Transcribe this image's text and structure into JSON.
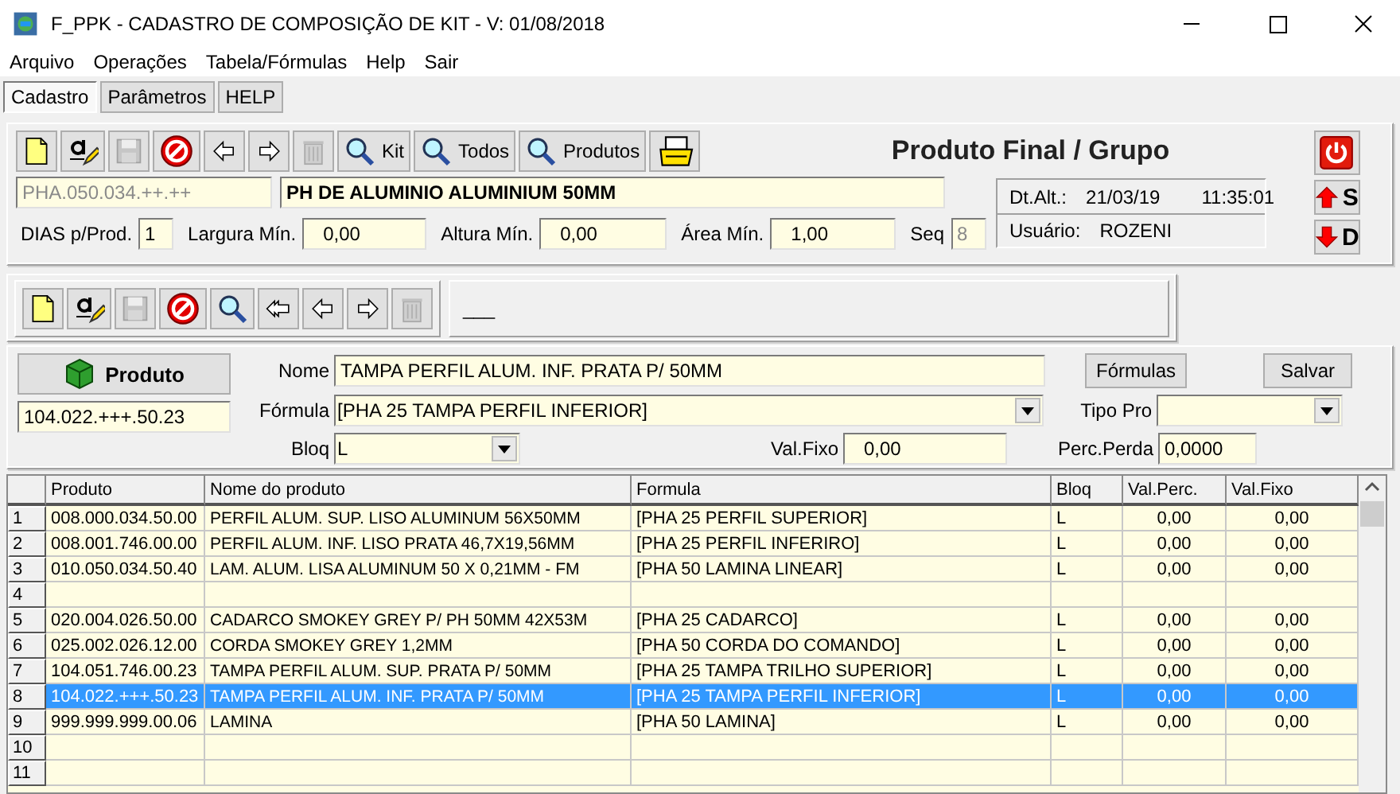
{
  "window": {
    "title": "F_PPK - CADASTRO DE COMPOSIÇÃO DE KIT - V: 01/08/2018"
  },
  "menu": [
    "Arquivo",
    "Operações",
    "Tabela/Fórmulas",
    "Help",
    "Sair"
  ],
  "tabs": [
    {
      "label": "Cadastro",
      "selected": true
    },
    {
      "label": "Parâmetros",
      "selected": false
    },
    {
      "label": "HELP",
      "selected": false
    }
  ],
  "header": {
    "toolbar": [
      {
        "kind": "new",
        "disabled": false
      },
      {
        "kind": "edit",
        "disabled": false
      },
      {
        "kind": "save",
        "disabled": true
      },
      {
        "kind": "cancel",
        "disabled": false
      },
      {
        "kind": "prev",
        "disabled": false
      },
      {
        "kind": "next",
        "disabled": false
      },
      {
        "kind": "delete",
        "disabled": true
      },
      {
        "kind": "search",
        "disabled": false,
        "label": "Kit"
      },
      {
        "kind": "search",
        "disabled": false,
        "label": "Todos"
      },
      {
        "kind": "search",
        "disabled": false,
        "label": "Produtos"
      },
      {
        "kind": "print",
        "disabled": false
      }
    ],
    "title": "Produto Final / Grupo",
    "code": {
      "value": "PHA.050.034.++.++",
      "disabled": true
    },
    "name": {
      "value": "PH DE ALUMINIO ALUMINIUM 50MM"
    },
    "fields": [
      {
        "label": "DIAS p/Prod.",
        "value": "1",
        "disabled": false
      },
      {
        "label": "Largura Mín.",
        "value": "0,00",
        "disabled": false
      },
      {
        "label": "Altura Mín.",
        "value": "0,00",
        "disabled": false
      },
      {
        "label": "Área Mín.",
        "value": "1,00",
        "disabled": false
      },
      {
        "label": "Seq",
        "value": "8",
        "disabled": true
      }
    ],
    "info": {
      "date_label": "Dt.Alt.:",
      "date": "21/03/19",
      "time": "11:35:01",
      "user_label": "Usuário:",
      "user": "ROZENI"
    },
    "side_buttons": [
      {
        "kind": "power"
      },
      {
        "kind": "up",
        "label": "S"
      },
      {
        "kind": "down",
        "label": "D"
      }
    ]
  },
  "detail": {
    "toolbar": [
      {
        "kind": "new",
        "disabled": false
      },
      {
        "kind": "edit",
        "disabled": false
      },
      {
        "kind": "save",
        "disabled": true
      },
      {
        "kind": "cancel",
        "disabled": false
      },
      {
        "kind": "search",
        "disabled": false
      },
      {
        "kind": "first",
        "disabled": false
      },
      {
        "kind": "prev",
        "disabled": false
      },
      {
        "kind": "next",
        "disabled": false
      },
      {
        "kind": "delete",
        "disabled": true
      }
    ],
    "caption": "___"
  },
  "form": {
    "product_button": "Produto",
    "code": "104.022.+++.50.23",
    "nome": {
      "label": "Nome",
      "value": "TAMPA PERFIL ALUM. INF. PRATA P/ 50MM"
    },
    "formula": {
      "label": "Fórmula",
      "value": "[PHA 25 TAMPA PERFIL INFERIOR]"
    },
    "bloq": {
      "label": "Bloq",
      "value": "L"
    },
    "formulas_button": "Fórmulas",
    "save_button": "Salvar",
    "tipo_pro": {
      "label": "Tipo Pro"
    },
    "val_fixo": {
      "label": "Val.Fixo",
      "value": "0,00"
    },
    "perc_perda": {
      "label": "Perc.Perda",
      "value": "0,0000"
    }
  },
  "grid": {
    "columns": [
      "Produto",
      "Nome do produto",
      "Formula",
      "Bloq",
      "Val.Perc.",
      "Val.Fixo"
    ],
    "rows": [
      {
        "number": "1",
        "selected": false,
        "cells": [
          "008.000.034.50.00",
          "PERFIL ALUM. SUP. LISO ALUMINUM 56X50MM",
          "[PHA 25 PERFIL SUPERIOR]",
          "L",
          "0,00",
          "0,00"
        ]
      },
      {
        "number": "2",
        "selected": false,
        "cells": [
          "008.001.746.00.00",
          "PERFIL ALUM. INF. LISO  PRATA 46,7X19,56MM",
          "[PHA 25 PERFIL INFERIRO]",
          "L",
          "0,00",
          "0,00"
        ]
      },
      {
        "number": "3",
        "selected": false,
        "cells": [
          "010.050.034.50.40",
          "LAM. ALUM. LISA ALUMINUM 50 X 0,21MM - FM",
          "[PHA 50 LAMINA LINEAR]",
          "L",
          "0,00",
          "0,00"
        ]
      },
      {
        "number": "4",
        "selected": false
      },
      {
        "number": "5",
        "selected": false,
        "cells": [
          "020.004.026.50.00",
          "CADARCO SMOKEY GREY P/ PH 50MM 42X53M",
          "[PHA 25 CADARCO]",
          "L",
          "0,00",
          "0,00"
        ]
      },
      {
        "number": "6",
        "selected": false,
        "cells": [
          "025.002.026.12.00",
          "CORDA SMOKEY GREY 1,2MM",
          "[PHA 50 CORDA DO COMANDO]",
          "L",
          "0,00",
          "0,00"
        ]
      },
      {
        "number": "7",
        "selected": false,
        "cells": [
          "104.051.746.00.23",
          "TAMPA PERFIL ALUM. SUP. PRATA P/ 50MM",
          "[PHA 25 TAMPA TRILHO SUPERIOR]",
          "L",
          "0,00",
          "0,00"
        ]
      },
      {
        "number": "8",
        "selected": true,
        "cells": [
          "104.022.+++.50.23",
          "TAMPA PERFIL ALUM. INF. PRATA P/ 50MM",
          "[PHA 25 TAMPA PERFIL INFERIOR]",
          "L",
          "0,00",
          "0,00"
        ]
      },
      {
        "number": "9",
        "selected": false,
        "cells": [
          "999.999.999.00.06",
          "LAMINA",
          "[PHA 50 LAMINA]",
          "L",
          "0,00",
          "0,00"
        ]
      },
      {
        "number": "10",
        "selected": false
      },
      {
        "number": "11",
        "selected": false
      }
    ]
  }
}
